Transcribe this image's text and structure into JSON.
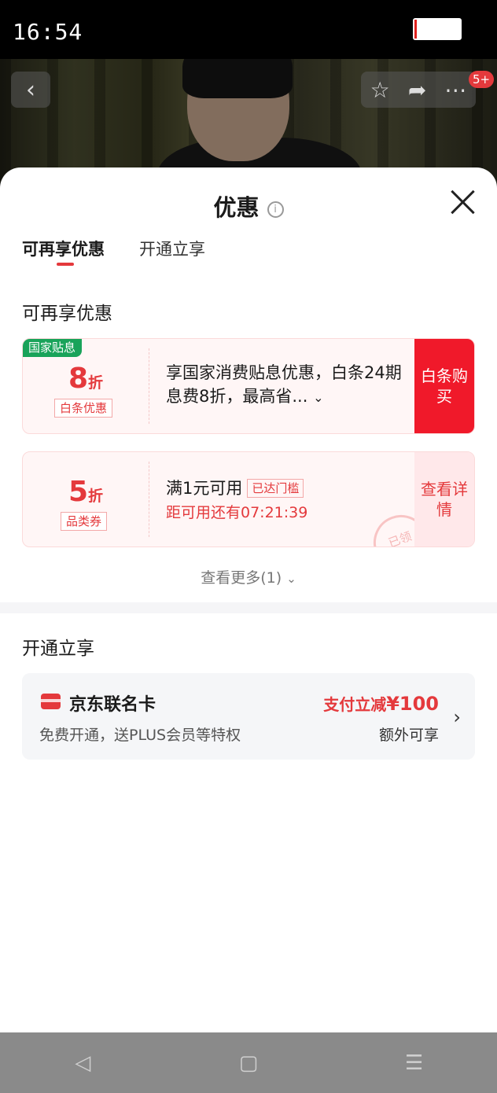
{
  "status_bar": {
    "time": "16:54"
  },
  "header": {
    "badge": "5+"
  },
  "sheet": {
    "title": "优惠",
    "tabs": [
      {
        "label": "可再享优惠",
        "active": true
      },
      {
        "label": "开通立享",
        "active": false
      }
    ],
    "section_discounts": {
      "title": "可再享优惠",
      "cards": [
        {
          "corner_tag": "国家贴息",
          "value": "8",
          "unit": "折",
          "tag": "白条优惠",
          "description": "享国家消费贴息优惠，白条24期息费8折，最高省...",
          "action": "白条购买"
        },
        {
          "value": "5",
          "unit": "折",
          "tag": "品类券",
          "condition": "满1元可用",
          "threshold": "已达门槛",
          "countdown": "距可用还有07:21:39",
          "stamp": "已领",
          "action": "查看详情"
        }
      ],
      "more": "查看更多(1)"
    },
    "section_open": {
      "title": "开通立享",
      "card": {
        "name": "京东联名卡",
        "subtitle": "免费开通，送PLUS会员等特权",
        "promo_prefix": "支付立减",
        "promo_amount": "¥100",
        "extra": "额外可享"
      }
    }
  },
  "colors": {
    "accent": "#e4393c",
    "green_tag": "#19a35a"
  },
  "icons": [
    "back-icon",
    "star-icon",
    "share-icon",
    "more-icon",
    "info-icon",
    "close-icon",
    "card-icon",
    "chevron-right-icon"
  ]
}
